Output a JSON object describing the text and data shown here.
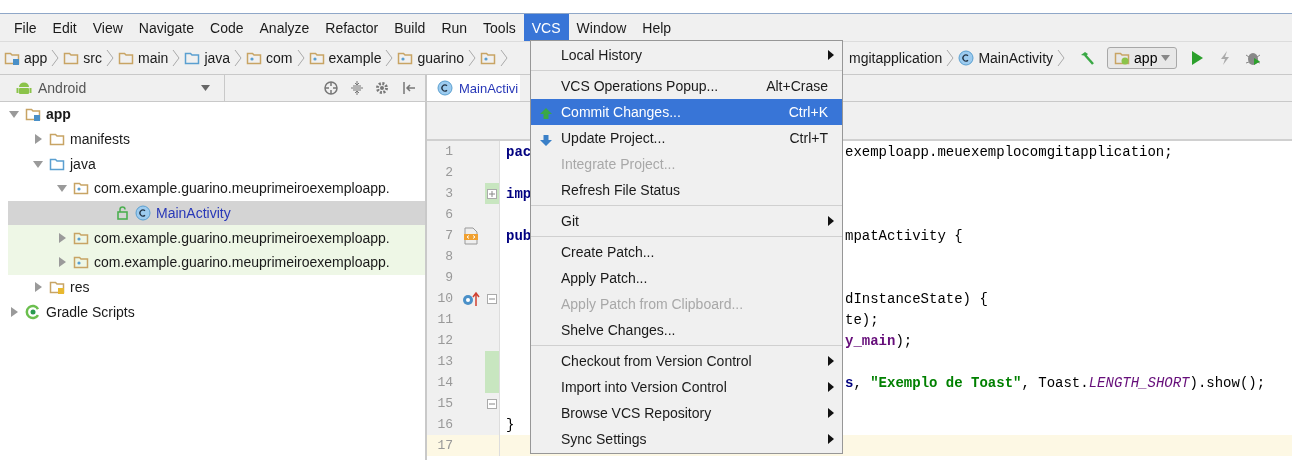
{
  "menubar": [
    {
      "label": "File",
      "selected": false
    },
    {
      "label": "Edit",
      "selected": false
    },
    {
      "label": "View",
      "selected": false
    },
    {
      "label": "Navigate",
      "selected": false
    },
    {
      "label": "Code",
      "selected": false
    },
    {
      "label": "Analyze",
      "selected": false
    },
    {
      "label": "Refactor",
      "selected": false
    },
    {
      "label": "Build",
      "selected": false
    },
    {
      "label": "Run",
      "selected": false
    },
    {
      "label": "Tools",
      "selected": false
    },
    {
      "label": "VCS",
      "selected": true
    },
    {
      "label": "Window",
      "selected": false
    },
    {
      "label": "Help",
      "selected": false
    }
  ],
  "breadcrumb": {
    "left": [
      {
        "kind": "module",
        "label": "app"
      },
      {
        "kind": "folder",
        "label": "src"
      },
      {
        "kind": "folder",
        "label": "main"
      },
      {
        "kind": "source",
        "label": "java"
      },
      {
        "kind": "package",
        "label": "com"
      },
      {
        "kind": "package",
        "label": "example"
      },
      {
        "kind": "package",
        "label": "guarino"
      },
      {
        "kind": "package"
      }
    ],
    "right": [
      {
        "kind": "text",
        "label": "mgitapplication"
      },
      {
        "kind": "class",
        "label": "MainActivity"
      }
    ]
  },
  "run_config": "app",
  "project_view": "Android",
  "tree": [
    {
      "kind": "module",
      "label": "app",
      "expanded": true,
      "selected": false,
      "highlighted": false,
      "modified": false,
      "children": [
        {
          "kind": "folder",
          "label": "manifests",
          "expanded": false,
          "selected": false,
          "highlighted": false,
          "modified": false
        },
        {
          "kind": "source",
          "label": "java",
          "expanded": true,
          "selected": false,
          "highlighted": false,
          "modified": false,
          "children": [
            {
              "kind": "package",
              "label": "com.example.guarino.meuprimeiroexemploapp.",
              "expanded": true,
              "selected": false,
              "highlighted": false,
              "modified": false,
              "children": [
                {
                  "kind": "class",
                  "label": "MainActivity",
                  "selected": true,
                  "highlighted": false,
                  "modified": true
                }
              ]
            },
            {
              "kind": "package",
              "label": "com.example.guarino.meuprimeiroexemploapp.",
              "expanded": false,
              "selected": false,
              "highlighted": true,
              "modified": false
            },
            {
              "kind": "package",
              "label": "com.example.guarino.meuprimeiroexemploapp.",
              "expanded": false,
              "selected": false,
              "highlighted": true,
              "modified": false
            }
          ]
        },
        {
          "kind": "res",
          "label": "res",
          "expanded": false,
          "selected": false,
          "highlighted": false,
          "modified": false
        }
      ]
    },
    {
      "kind": "gradle",
      "label": "Gradle Scripts",
      "expanded": false,
      "selected": false,
      "highlighted": false,
      "modified": false
    }
  ],
  "editor": {
    "tab": "MainActivi",
    "lines": [
      {
        "number": "1",
        "changed": false,
        "current": false,
        "left": [
          {
            "kind": "keyword",
            "text": "pac"
          }
        ],
        "right": [
          {
            "kind": "plain",
            "text": "exemploapp.meuexemplocomgitapplication;"
          }
        ]
      },
      {
        "number": "2",
        "changed": false,
        "current": false
      },
      {
        "number": "3",
        "changed": true,
        "current": false,
        "fold": {
          "kind": "expand"
        },
        "left": [
          {
            "kind": "keyword",
            "text": "imp"
          }
        ]
      },
      {
        "number": "6",
        "changed": false,
        "current": false
      },
      {
        "number": "7",
        "changed": false,
        "current": false,
        "marker": {
          "kind": "layout"
        },
        "left": [
          {
            "kind": "keyword",
            "text": "pub"
          }
        ],
        "right": [
          {
            "kind": "plain",
            "text": "mpatActivity {"
          }
        ]
      },
      {
        "number": "8",
        "changed": false,
        "current": false
      },
      {
        "number": "9",
        "changed": false,
        "current": false
      },
      {
        "number": "10",
        "changed": false,
        "current": false,
        "marker": {
          "kind": "override"
        },
        "fold": {
          "kind": "collapse"
        },
        "right": [
          {
            "kind": "plain",
            "text": "dInstanceState) {"
          }
        ]
      },
      {
        "number": "11",
        "changed": false,
        "current": false,
        "right": [
          {
            "kind": "plain",
            "text": "te);"
          }
        ]
      },
      {
        "number": "12",
        "changed": false,
        "current": false,
        "right": [
          {
            "kind": "field",
            "text": "y_main"
          },
          {
            "kind": "plain",
            "text": ");"
          }
        ]
      },
      {
        "number": "13",
        "changed": true,
        "current": false
      },
      {
        "number": "14",
        "changed": true,
        "current": false,
        "right": [
          {
            "kind": "keyword",
            "text": "s"
          },
          {
            "kind": "plain",
            "text": ", "
          },
          {
            "kind": "string",
            "text": "\"Exemplo de Toast\""
          },
          {
            "kind": "plain",
            "text": ", Toast."
          },
          {
            "kind": "static",
            "text": "LENGTH_SHORT"
          },
          {
            "kind": "plain",
            "text": ").show();"
          }
        ]
      },
      {
        "number": "15",
        "changed": false,
        "current": false,
        "fold": {
          "kind": "collapse"
        }
      },
      {
        "number": "16",
        "changed": false,
        "current": false,
        "left": [
          {
            "kind": "plain",
            "text": "}"
          }
        ]
      },
      {
        "number": "17",
        "changed": false,
        "current": true
      }
    ]
  },
  "menu": {
    "items": [
      {
        "kind": "item",
        "label": "Local History",
        "submenu": true,
        "disabled": false,
        "selected": false
      },
      {
        "kind": "separator"
      },
      {
        "kind": "item",
        "label": "VCS Operations Popup...",
        "shortcut": "Alt+Crase",
        "submenu": false,
        "disabled": false,
        "selected": false
      },
      {
        "kind": "commit",
        "label": "Commit Changes...",
        "shortcut": "Ctrl+K",
        "submenu": false,
        "disabled": false,
        "selected": true
      },
      {
        "kind": "update",
        "label": "Update Project...",
        "shortcut": "Ctrl+T",
        "submenu": false,
        "disabled": false,
        "selected": false
      },
      {
        "kind": "item",
        "label": "Integrate Project...",
        "submenu": false,
        "disabled": true,
        "selected": false
      },
      {
        "kind": "item",
        "label": "Refresh File Status",
        "submenu": false,
        "disabled": false,
        "selected": false
      },
      {
        "kind": "separator"
      },
      {
        "kind": "item",
        "label": "Git",
        "submenu": true,
        "disabled": false,
        "selected": false
      },
      {
        "kind": "separator"
      },
      {
        "kind": "item",
        "label": "Create Patch...",
        "submenu": false,
        "disabled": false,
        "selected": false
      },
      {
        "kind": "item",
        "label": "Apply Patch...",
        "submenu": false,
        "disabled": false,
        "selected": false
      },
      {
        "kind": "item",
        "label": "Apply Patch from Clipboard...",
        "submenu": false,
        "disabled": true,
        "selected": false
      },
      {
        "kind": "item",
        "label": "Shelve Changes...",
        "submenu": false,
        "disabled": false,
        "selected": false
      },
      {
        "kind": "separator"
      },
      {
        "kind": "item",
        "label": "Checkout from Version Control",
        "submenu": true,
        "disabled": false,
        "selected": false
      },
      {
        "kind": "item",
        "label": "Import into Version Control",
        "submenu": true,
        "disabled": false,
        "selected": false
      },
      {
        "kind": "item",
        "label": "Browse VCS Repository",
        "submenu": true,
        "disabled": false,
        "selected": false
      },
      {
        "kind": "item",
        "label": "Sync Settings",
        "submenu": true,
        "disabled": false,
        "selected": false
      }
    ]
  }
}
